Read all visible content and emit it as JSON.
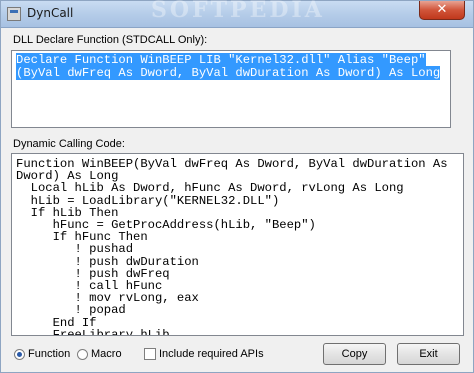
{
  "window": {
    "title": "DynCall",
    "watermark": "SOFTPEDIA",
    "close_label": "✕"
  },
  "declare": {
    "label": "DLL Declare Function (STDCALL Only):",
    "lines": [
      "Declare Function WinBEEP LIB \"Kernel32.dll\" Alias \"Beep\"",
      "(ByVal dwFreq As Dword, ByVal dwDuration As Dword) As Long"
    ]
  },
  "code": {
    "label": "Dynamic Calling Code:",
    "lines": [
      "Function WinBEEP(ByVal dwFreq As Dword, ByVal dwDuration As",
      "Dword) As Long",
      "  Local hLib As Dword, hFunc As Dword, rvLong As Long",
      "  hLib = LoadLibrary(\"KERNEL32.DLL\")",
      "  If hLib Then",
      "     hFunc = GetProcAddress(hLib, \"Beep\")",
      "     If hFunc Then",
      "        ! pushad",
      "        ! push dwDuration",
      "        ! push dwFreq",
      "        ! call hFunc",
      "        ! mov rvLong, eax",
      "        ! popad",
      "     End If",
      "     FreeLibrary hLib"
    ]
  },
  "options": {
    "function_label": "Function",
    "macro_label": "Macro",
    "include_apis_label": "Include required APIs",
    "selected": "Function"
  },
  "buttons": {
    "copy_label": "Copy",
    "exit_label": "Exit"
  }
}
